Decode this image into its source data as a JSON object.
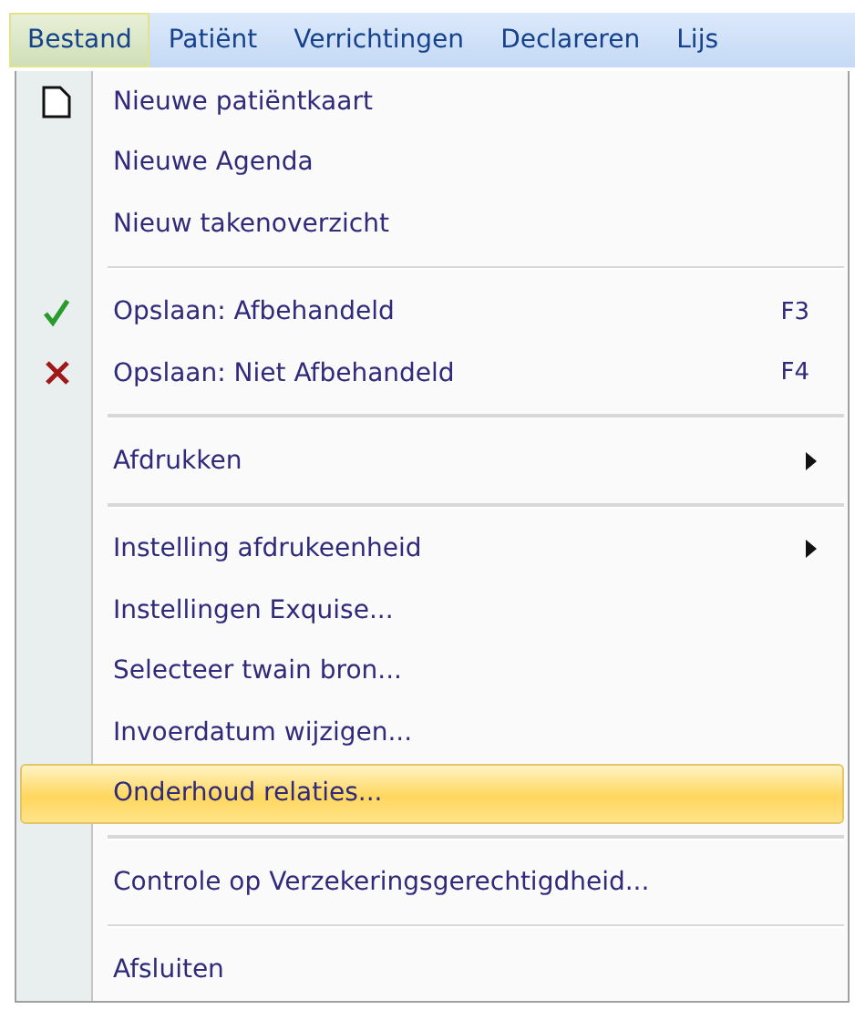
{
  "menubar": [
    {
      "label": "Bestand",
      "selected": true
    },
    {
      "label": "Patiënt",
      "selected": false
    },
    {
      "label": "Verrichtingen",
      "selected": false
    },
    {
      "label": "Declareren",
      "selected": false
    },
    {
      "label": "Lijs",
      "selected": false
    }
  ],
  "menu": [
    {
      "kind": "page",
      "label": "Nieuwe patiëntkaart",
      "selected": false
    },
    {
      "kind": "item",
      "label": "Nieuwe Agenda",
      "selected": false
    },
    {
      "kind": "item",
      "label": "Nieuw takenoverzicht",
      "selected": false
    },
    {
      "kind": "separator"
    },
    {
      "kind": "check",
      "label": "Opslaan: Afbehandeld",
      "shortcut": "F3",
      "selected": false
    },
    {
      "kind": "cross",
      "label": "Opslaan: Niet Afbehandeld",
      "shortcut": "F4",
      "selected": false
    },
    {
      "kind": "separator"
    },
    {
      "kind": "submenu",
      "label": "Afdrukken",
      "selected": false
    },
    {
      "kind": "separator"
    },
    {
      "kind": "submenu",
      "label": "Instelling afdrukeenheid",
      "selected": false
    },
    {
      "kind": "item",
      "label": "Instellingen Exquise...",
      "selected": false
    },
    {
      "kind": "item",
      "label": "Selecteer twain bron...",
      "selected": false
    },
    {
      "kind": "item",
      "label": "Invoerdatum wijzigen...",
      "selected": false
    },
    {
      "kind": "item",
      "label": "Onderhoud relaties...",
      "selected": true
    },
    {
      "kind": "separator"
    },
    {
      "kind": "item",
      "label": "Controle op Verzekeringsgerechtigdheid...",
      "selected": false
    },
    {
      "kind": "separator"
    },
    {
      "kind": "item",
      "label": "Afsluiten",
      "selected": false
    }
  ]
}
